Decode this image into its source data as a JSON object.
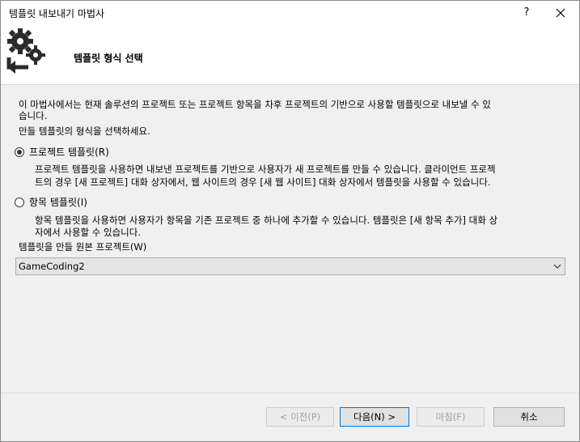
{
  "window": {
    "title": "템플릿 내보내기 마법사",
    "help_label": "?"
  },
  "header": {
    "title": "템플릿 형식 선택"
  },
  "intro": {
    "line1": "이 마법사에서는 현재 솔루션의 프로젝트 또는 프로젝트 항목을 차후 프로젝트의 기반으로 사용할 템플릿으로 내보낼 수 있",
    "line2": "습니다.",
    "prompt": "만들 템플릿의 형식을 선택하세요."
  },
  "options": [
    {
      "label": "프로젝트 템플릿(R)",
      "selected": true,
      "desc1": "프로젝트 템플릿을 사용하면 내보낸 프로젝트를 기반으로 사용자가 새 프로젝트를 만들 수 있습니다. 클라이언트 프로젝",
      "desc2": "트의 경우 [새 프로젝트] 대화 상자에서, 웹 사이트의 경우 [새 웹 사이트] 대화 상자에서 템플릿을 사용할 수 있습니다."
    },
    {
      "label": "항목 템플릿(I)",
      "selected": false,
      "desc1": "항목 템플릿을 사용하면 사용자가 항목을 기존 프로젝트 중 하나에 추가할 수 있습니다. 템플릿은 [새 항목 추가] 대화 상",
      "desc2": "자에서 사용할 수 있습니다."
    }
  ],
  "source_project": {
    "label": "템플릿을 만들 원본 프로젝트(W)",
    "value": "GameCoding2"
  },
  "buttons": {
    "prev": "< 이전(P)",
    "next": "다음(N) >",
    "finish": "마침(F)",
    "cancel": "취소"
  }
}
